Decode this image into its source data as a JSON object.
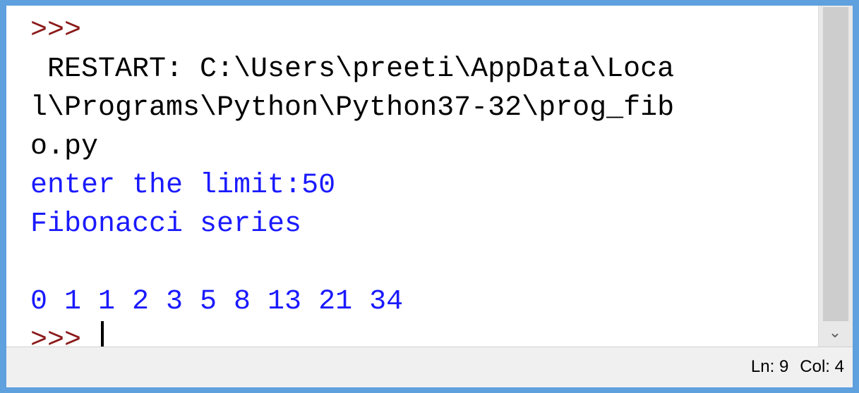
{
  "shell": {
    "lines": [
      {
        "kind": "prompt",
        "text": ">>>"
      },
      {
        "kind": "restart",
        "text": " RESTART: C:\\Users\\preeti\\AppData\\Loca"
      },
      {
        "kind": "restart",
        "text": "l\\Programs\\Python\\Python37-32\\prog_fib"
      },
      {
        "kind": "restart",
        "text": "o.py"
      },
      {
        "kind": "out",
        "text": "enter the limit:50"
      },
      {
        "kind": "out",
        "text": "Fibonacci series"
      },
      {
        "kind": "out",
        "text": ""
      },
      {
        "kind": "out",
        "text": "0 1 1 2 3 5 8 13 21 34"
      }
    ],
    "current_prompt": ">>> "
  },
  "statusbar": {
    "line": "Ln: 9",
    "col": "Col: 4"
  },
  "colors": {
    "prompt": "#8b1a1a",
    "output": "#1a1aff",
    "frame": "#5fa0de"
  },
  "icons": {
    "scroll_down": "chevron-down-icon"
  }
}
